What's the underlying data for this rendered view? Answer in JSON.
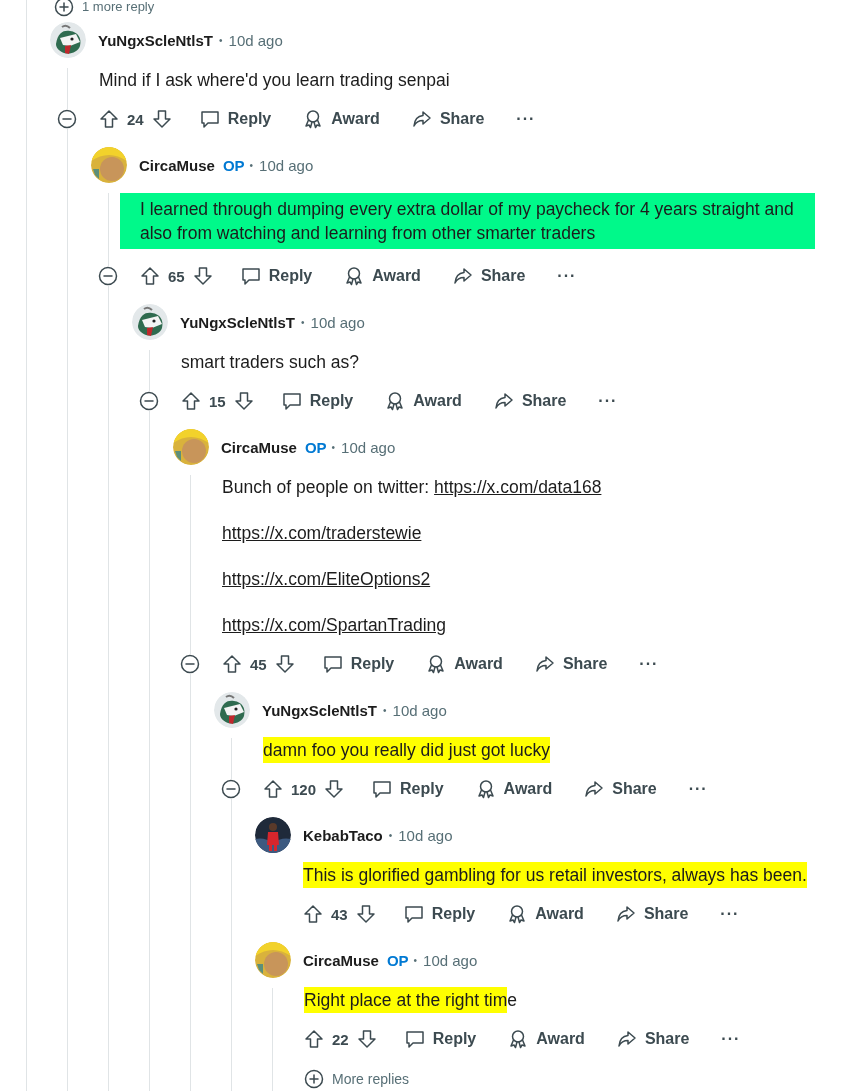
{
  "top_more_replies": "1 more reply",
  "comments": [
    {
      "user": "YuNgxScleNtlsT",
      "op": false,
      "separator": "•",
      "time": "10d ago",
      "avatar": {
        "kind": "goat"
      },
      "paragraphs": [
        [
          {
            "text": "Mind if I ask where'd you learn trading senpai"
          }
        ]
      ],
      "score": "24",
      "actions": [
        "Reply",
        "Award",
        "Share"
      ],
      "more": "···",
      "children": [
        {
          "user": "CircaMuse",
          "op": true,
          "op_label": "OP",
          "separator": "•",
          "time": "10d ago",
          "avatar": {
            "kind": "yellow"
          },
          "highlight": {
            "kind": "block",
            "color": "#00f98a"
          },
          "paragraphs": [
            [
              {
                "text": "I learned through dumping every extra dollar of my paycheck for 4 years straight and also from watching and learning from other smarter traders"
              }
            ]
          ],
          "score": "65",
          "actions": [
            "Reply",
            "Award",
            "Share"
          ],
          "more": "···",
          "children": [
            {
              "user": "YuNgxScleNtlsT",
              "op": false,
              "separator": "•",
              "time": "10d ago",
              "avatar": {
                "kind": "goat"
              },
              "paragraphs": [
                [
                  {
                    "text": "smart traders such as?"
                  }
                ]
              ],
              "score": "15",
              "actions": [
                "Reply",
                "Award",
                "Share"
              ],
              "more": "···",
              "children": [
                {
                  "user": "CircaMuse",
                  "op": true,
                  "op_label": "OP",
                  "separator": "•",
                  "time": "10d ago",
                  "avatar": {
                    "kind": "yellow"
                  },
                  "paragraphs": [
                    [
                      {
                        "text": "Bunch of people on twitter: "
                      },
                      {
                        "text": "https://x.com/data168",
                        "link": true
                      }
                    ],
                    [
                      {
                        "text": "https://x.com/traderstewie",
                        "link": true
                      }
                    ],
                    [
                      {
                        "text": "https://x.com/EliteOptions2",
                        "link": true
                      }
                    ],
                    [
                      {
                        "text": "https://x.com/SpartanTrading",
                        "link": true
                      }
                    ]
                  ],
                  "score": "45",
                  "actions": [
                    "Reply",
                    "Award",
                    "Share"
                  ],
                  "more": "···",
                  "children": [
                    {
                      "user": "YuNgxScleNtlsT",
                      "op": false,
                      "separator": "•",
                      "time": "10d ago",
                      "avatar": {
                        "kind": "goat"
                      },
                      "paragraphs": [
                        [
                          {
                            "text": "damn foo you really did just got lucky",
                            "kind": "highlight",
                            "color": "#ffff00"
                          }
                        ]
                      ],
                      "score": "120",
                      "actions": [
                        "Reply",
                        "Award",
                        "Share"
                      ],
                      "more": "···",
                      "children": [
                        {
                          "user": "KebabTaco",
                          "op": false,
                          "separator": "•",
                          "time": "10d ago",
                          "avatar": {
                            "kind": "red"
                          },
                          "paragraphs": [
                            [
                              {
                                "text": "This is glorified gambling for us retail investors, always has been.",
                                "kind": "highlight",
                                "color": "#ffff00"
                              }
                            ]
                          ],
                          "score": "43",
                          "actions": [
                            "Reply",
                            "Award",
                            "Share"
                          ],
                          "more": "···"
                        },
                        {
                          "user": "CircaMuse",
                          "op": true,
                          "op_label": "OP",
                          "separator": "•",
                          "time": "10d ago",
                          "avatar": {
                            "kind": "yellow"
                          },
                          "paragraphs": [
                            [
                              {
                                "text": "Right place at the right tim",
                                "kind": "highlight",
                                "color": "#ffff00"
                              },
                              {
                                "text": "e"
                              }
                            ]
                          ],
                          "score": "22",
                          "actions": [
                            "Reply",
                            "Award",
                            "Share"
                          ],
                          "more": "···",
                          "more_replies": "More replies"
                        }
                      ]
                    }
                  ]
                }
              ]
            }
          ]
        }
      ]
    }
  ]
}
